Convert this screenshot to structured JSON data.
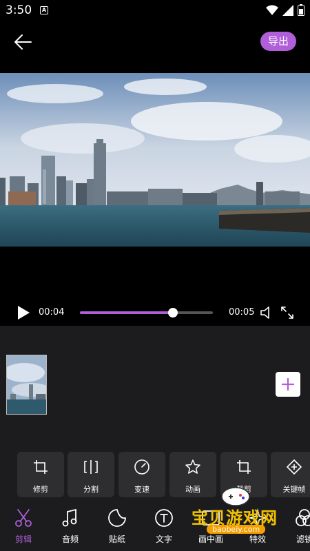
{
  "status": {
    "time": "3:50",
    "notification_icon": "a-icon"
  },
  "header": {
    "back_icon": "arrow-left-icon",
    "export_label": "导出",
    "accent": "#b05fd8"
  },
  "player": {
    "current_time": "00:04",
    "total_time": "00:05",
    "progress": 0.7
  },
  "tools": [
    {
      "label": "修剪",
      "icon": "crop-icon"
    },
    {
      "label": "分割",
      "icon": "split-icon"
    },
    {
      "label": "变速",
      "icon": "speed-gauge-icon"
    },
    {
      "label": "动画",
      "icon": "star-icon"
    },
    {
      "label": "裁剪",
      "icon": "crop-icon"
    },
    {
      "label": "关键帧",
      "icon": "keyframe-icon"
    }
  ],
  "tabs": [
    {
      "label": "剪辑",
      "icon": "scissors-icon",
      "active": true
    },
    {
      "label": "音频",
      "icon": "music-note-icon"
    },
    {
      "label": "贴纸",
      "icon": "sticker-icon"
    },
    {
      "label": "文字",
      "icon": "text-icon"
    },
    {
      "label": "画中画",
      "icon": "pip-icon"
    },
    {
      "label": "特效",
      "icon": "effects-icon"
    },
    {
      "label": "滤镜",
      "icon": "filter-icon"
    }
  ],
  "watermark": {
    "text": "宝贝游戏网",
    "url": "baobeiy.com"
  }
}
